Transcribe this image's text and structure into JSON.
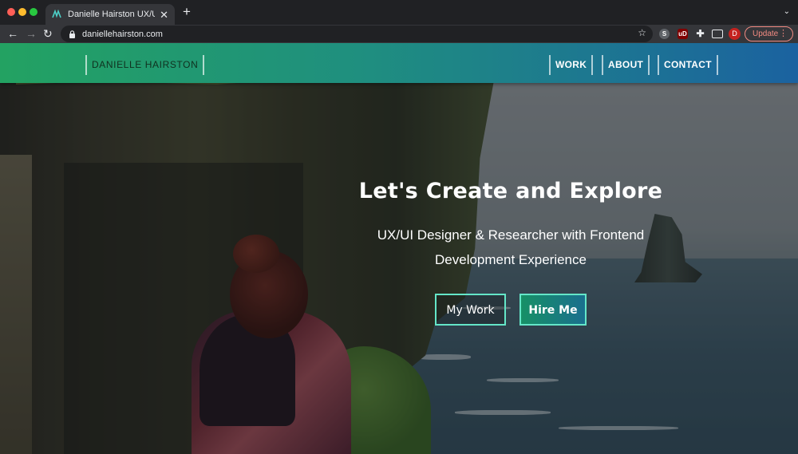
{
  "browser": {
    "tab_title": "Danielle Hairston UX/UI Design",
    "url": "daniellehairston.com",
    "update_label": "Update",
    "profile_initial": "D",
    "ext_s_label": "S",
    "ext_ub_label": "uD",
    "tab_close": "✕",
    "new_tab": "+",
    "tab_menu": "⌄",
    "back": "←",
    "forward": "→",
    "reload": "↻",
    "star": "☆",
    "puzzle": "✚",
    "menu_dots": "⋮"
  },
  "header": {
    "logo_text": "DANIELLE HAIRSTON",
    "nav": {
      "work": "WORK",
      "about": "ABOUT",
      "contact": "CONTACT"
    }
  },
  "hero": {
    "title": "Let's Create and Explore",
    "subtitle_line1": "UX/UI Designer & Researcher with Frontend",
    "subtitle_line2": "Development Experience",
    "buttons": {
      "my_work": "My Work",
      "hire_me": "Hire Me"
    }
  },
  "colors": {
    "header_gradient_start": "#23a262",
    "header_gradient_end": "#1b62a0",
    "button_border": "#64e6c8",
    "update_accent": "#f28b82"
  }
}
